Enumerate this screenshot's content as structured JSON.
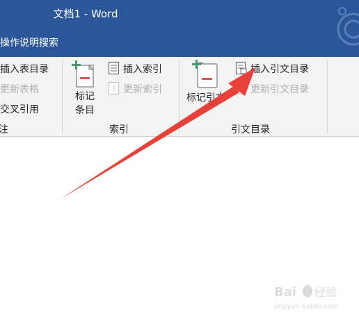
{
  "window": {
    "title": "文档1 - Word"
  },
  "tell_me": {
    "label": "操作说明搜索"
  },
  "ribbon": {
    "captions": {
      "insert_table_of_figures": "插入表目录",
      "update_table": "更新表格",
      "cross_reference": "交叉引用",
      "group_tail": "注",
      "mark_entry_line1": "标记",
      "mark_entry_line2": "条目",
      "insert_index": "插入索引",
      "update_index": "更新索引",
      "index_group": "索引",
      "mark_citation": "标记引文",
      "insert_table_of_authorities": "插入引文目录",
      "update_table_of_authorities": "更新引文目录",
      "toa_group": "引文目录"
    }
  },
  "colors": {
    "title_bar": "#2b579a",
    "ribbon_bg": "#f3f3f3",
    "annotation_arrow": "#e8413a",
    "green_plus": "#4a9a6b",
    "red_bar": "#d9534f"
  },
  "watermark": {
    "text": "Baidu经验",
    "subtext": "jingyan.baidu.com"
  }
}
